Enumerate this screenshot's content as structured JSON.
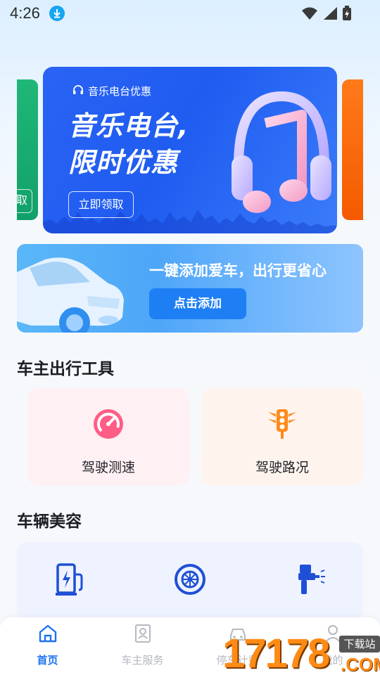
{
  "status_bar": {
    "time": "4:26"
  },
  "carousel": {
    "left_card_button": "取",
    "main_card": {
      "tag": "音乐电台优惠",
      "headline_line1": "音乐电台,",
      "headline_line2": "限时优惠",
      "button": "立即领取"
    }
  },
  "car_banner": {
    "title": "一键添加爱车，出行更省心",
    "button": "点击添加"
  },
  "tools_section": {
    "title": "车主出行工具",
    "items": [
      {
        "label": "驾驶测速",
        "icon": "speedometer-icon"
      },
      {
        "label": "驾驶路况",
        "icon": "traffic-light-icon"
      }
    ]
  },
  "beauty_section": {
    "title": "车辆美容",
    "icons": [
      "charging-station-icon",
      "tire-icon",
      "spray-gun-icon"
    ]
  },
  "bottom_nav": {
    "items": [
      {
        "label": "首页",
        "icon": "home-icon",
        "active": true
      },
      {
        "label": "车主服务",
        "icon": "id-card-icon",
        "active": false
      },
      {
        "label": "停车计费",
        "icon": "car-icon",
        "active": false
      },
      {
        "label": "我的",
        "icon": "user-icon",
        "active": false
      }
    ]
  },
  "watermark": {
    "digits": "17178",
    "badge": "下载站",
    "suffix": ".COM"
  },
  "colors": {
    "accent": "#1e73ee",
    "banner_blue": "#2a63f4",
    "tool_pink": "#fff0f4",
    "tool_orange": "#fff4ed"
  }
}
